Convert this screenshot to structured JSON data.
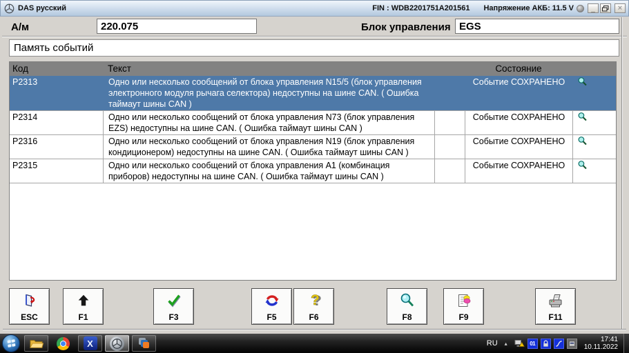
{
  "window": {
    "title": "DAS русский",
    "fin": "FIN : WDB2201751A201561",
    "battery_voltage": "Напряжение АКБ: 11.5 V",
    "controls": {
      "minimize": "_",
      "close": "×"
    }
  },
  "header": {
    "vehicle_label": "А/м",
    "vehicle_value": "220.075",
    "ecu_label": "Блок управления",
    "ecu_value": "EGS"
  },
  "section_title": "Память событий",
  "table": {
    "headers": {
      "code": "Код",
      "text": "Текст",
      "state": "Состояние"
    },
    "rows": [
      {
        "code": "P2313",
        "text": "Одно или несколько сообщений от блока управления N15/5 (блок управления электронного модуля рычага селектора) недоступны на шине CAN. ( Ошибка таймаут шины CAN )",
        "state": "Событие СОХРАНЕНО",
        "selected": true
      },
      {
        "code": "P2314",
        "text": "Одно или несколько сообщений от блока управления N73 (блок управления EZS) недоступны на шине CAN. ( Ошибка таймаут шины CAN )",
        "state": "Событие СОХРАНЕНО",
        "selected": false
      },
      {
        "code": "P2316",
        "text": "Одно или несколько сообщений от блока управления N19 (блок управления кондиционером) недоступны на шине CAN. ( Ошибка таймаут шины CAN )",
        "state": "Событие СОХРАНЕНО",
        "selected": false
      },
      {
        "code": "P2315",
        "text": "Одно или несколько сообщений от блока управления A1 (комбинация приборов) недоступны на шине CAN. ( Ошибка таймаут шины CAN )",
        "state": "Событие СОХРАНЕНО",
        "selected": false
      }
    ]
  },
  "function_keys": [
    {
      "label": "ESC",
      "icon": "exit-icon"
    },
    {
      "label": "F1",
      "icon": "arrow-up-icon"
    },
    {
      "label": "F3",
      "icon": "check-icon"
    },
    {
      "label": "F5",
      "icon": "refresh-icon"
    },
    {
      "label": "F6",
      "icon": "help-icon"
    },
    {
      "label": "F8",
      "icon": "magnifier-icon"
    },
    {
      "label": "F9",
      "icon": "document-edit-icon"
    },
    {
      "label": "F11",
      "icon": "printer-icon"
    }
  ],
  "taskbar": {
    "language": "RU",
    "tray_expand": "▴",
    "time": "17:41",
    "date": "10.11.2022",
    "counter_badge": "01",
    "apps": [
      "windows-start-orb",
      "explorer-icon",
      "chrome-icon",
      "xentry-icon",
      "mercedes-das-icon",
      "vmware-icon"
    ],
    "tray_icons": [
      "network-warning-icon",
      "counter-01-icon",
      "lock-icon",
      "cable-icon",
      "card-reader-icon"
    ]
  },
  "colors": {
    "selected_row": "#4e79a8",
    "table_header": "#828282",
    "client_bg": "#d6d3ce",
    "titlebar_top": "#f0f5fb",
    "titlebar_bottom": "#b3c8de",
    "taskbar_bg": "#050505"
  }
}
